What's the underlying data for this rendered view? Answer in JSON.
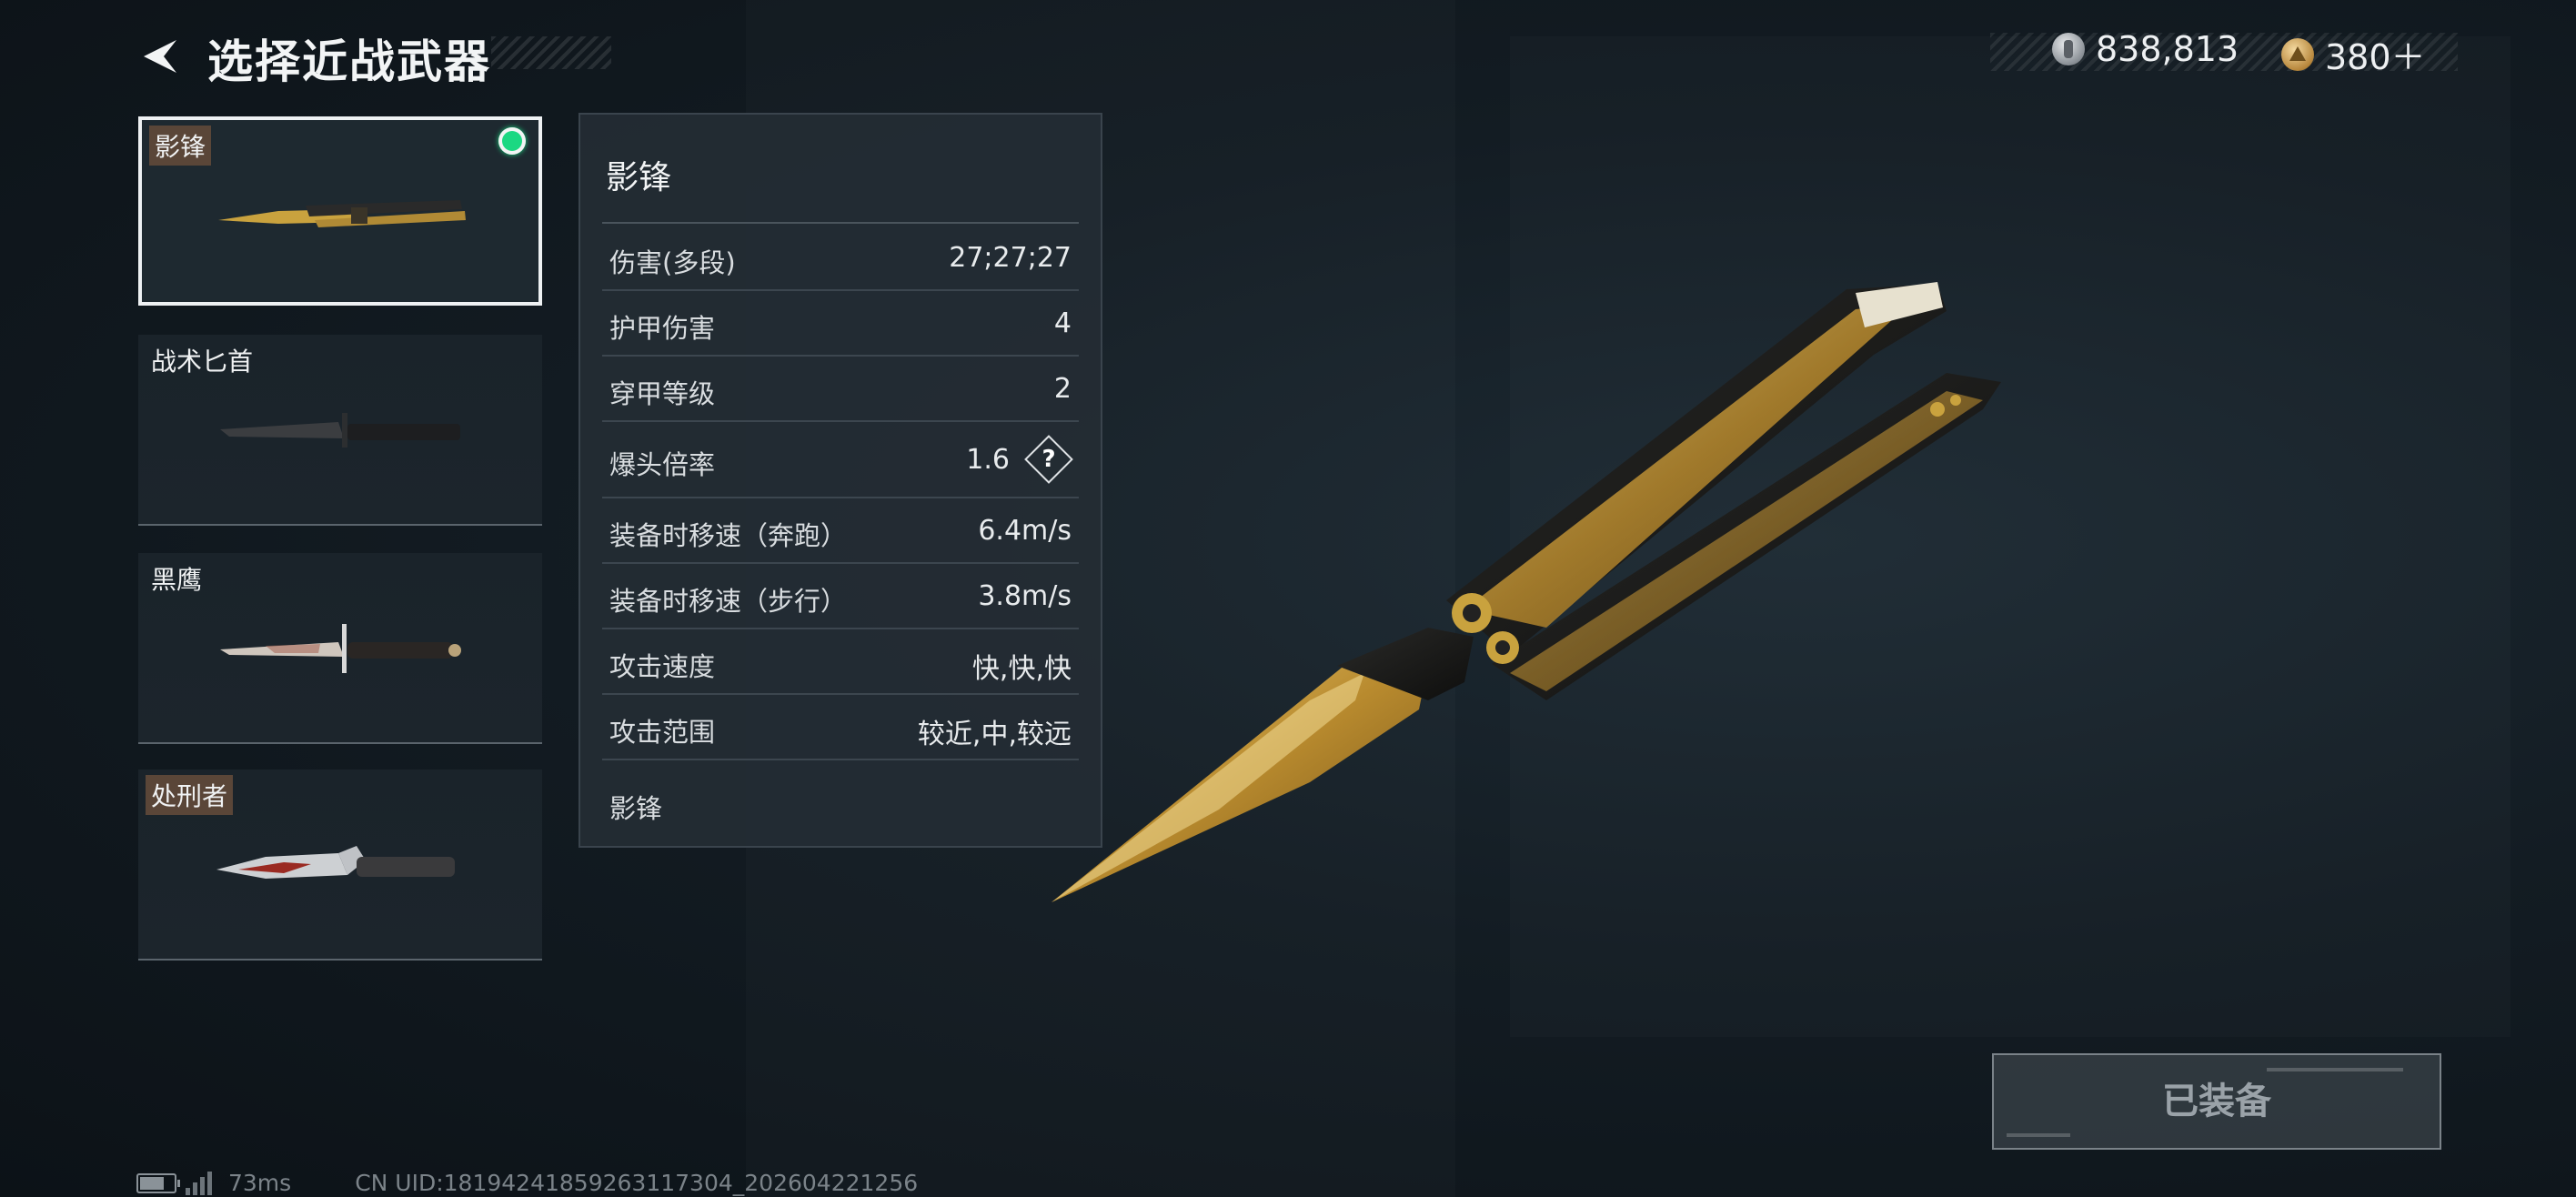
{
  "header": {
    "title": "选择近战武器",
    "currencies": [
      {
        "icon": "silver-coin-icon",
        "value": "838,813"
      },
      {
        "icon": "gold-coin-icon",
        "value": "380＋"
      }
    ]
  },
  "weapons": [
    {
      "name": "影锋",
      "selected": true,
      "equipped": true,
      "icon": "butterfly-knife-icon"
    },
    {
      "name": "战术匕首",
      "selected": false,
      "icon": "tactical-dagger-icon"
    },
    {
      "name": "黑鹰",
      "selected": false,
      "icon": "black-eagle-knife-icon"
    },
    {
      "name": "处刑者",
      "selected": false,
      "icon": "executioner-knife-icon"
    }
  ],
  "stats": {
    "title": "影锋",
    "rows": [
      {
        "label": "伤害(多段)",
        "value": "27;27;27"
      },
      {
        "label": "护甲伤害",
        "value": "4"
      },
      {
        "label": "穿甲等级",
        "value": "2"
      },
      {
        "label": "爆头倍率",
        "value": "1.6",
        "help": "?"
      },
      {
        "label": "装备时移速（奔跑）",
        "value": "6.4m/s"
      },
      {
        "label": "装备时移速（步行）",
        "value": "3.8m/s"
      },
      {
        "label": "攻击速度",
        "value": "快,快,快"
      },
      {
        "label": "攻击范围",
        "value": "较近,中,较远"
      }
    ],
    "footer": "影锋"
  },
  "equip_button": {
    "label": "已装备"
  },
  "status_bar": {
    "ping": "73ms",
    "uid": "CN UID:18194241859263117304_202604221256"
  },
  "colors": {
    "equipped_dot": "#1bd882",
    "gold": "#c9a23e"
  }
}
